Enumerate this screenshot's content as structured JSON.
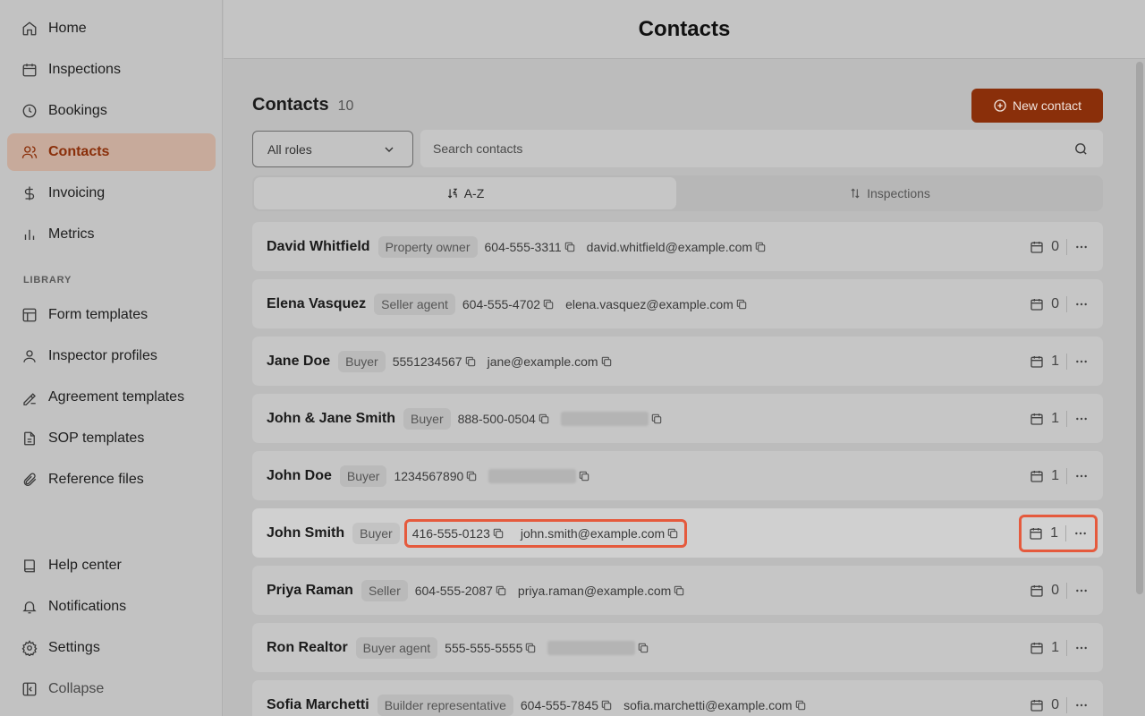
{
  "sidebar": {
    "items": [
      {
        "label": "Home",
        "icon": "home-icon"
      },
      {
        "label": "Inspections",
        "icon": "calendar-icon"
      },
      {
        "label": "Bookings",
        "icon": "clock-icon"
      },
      {
        "label": "Contacts",
        "icon": "users-icon",
        "active": true
      },
      {
        "label": "Invoicing",
        "icon": "dollar-icon"
      },
      {
        "label": "Metrics",
        "icon": "bar-chart-icon"
      }
    ],
    "library_label": "LIBRARY",
    "library_items": [
      {
        "label": "Form templates",
        "icon": "layout-icon"
      },
      {
        "label": "Inspector profiles",
        "icon": "user-icon"
      },
      {
        "label": "Agreement templates",
        "icon": "signature-icon"
      },
      {
        "label": "SOP templates",
        "icon": "file-icon"
      },
      {
        "label": "Reference files",
        "icon": "paperclip-icon"
      }
    ],
    "footer_items": [
      {
        "label": "Help center",
        "icon": "book-icon"
      },
      {
        "label": "Notifications",
        "icon": "bell-icon"
      },
      {
        "label": "Settings",
        "icon": "gear-icon"
      },
      {
        "label": "Collapse",
        "icon": "sidebar-collapse-icon"
      }
    ]
  },
  "header": {
    "title": "Contacts"
  },
  "main": {
    "section_title": "Contacts",
    "count": "10",
    "new_button": "New contact",
    "roles_select": "All roles",
    "search_placeholder": "Search contacts",
    "sort_tabs": [
      {
        "label": "A-Z",
        "active": true
      },
      {
        "label": "Inspections",
        "active": false
      }
    ]
  },
  "accent_color": "#8a2f0a",
  "highlight_color": "#e55a3d",
  "contacts": [
    {
      "name": "David Whitfield",
      "role": "Property owner",
      "phone": "604-555-3311",
      "email": "david.whitfield@example.com",
      "inspections": "0"
    },
    {
      "name": "Elena Vasquez",
      "role": "Seller agent",
      "phone": "604-555-4702",
      "email": "elena.vasquez@example.com",
      "inspections": "0"
    },
    {
      "name": "Jane Doe",
      "role": "Buyer",
      "phone": "5551234567",
      "email": "jane@example.com",
      "inspections": "1"
    },
    {
      "name": "John & Jane Smith",
      "role": "Buyer",
      "phone": "888-500-0504",
      "email": "",
      "inspections": "1"
    },
    {
      "name": "John Doe",
      "role": "Buyer",
      "phone": "1234567890",
      "email": "",
      "inspections": "1"
    },
    {
      "name": "John Smith",
      "role": "Buyer",
      "phone": "416-555-0123",
      "email": "john.smith@example.com",
      "inspections": "1",
      "highlighted": true
    },
    {
      "name": "Priya Raman",
      "role": "Seller",
      "phone": "604-555-2087",
      "email": "priya.raman@example.com",
      "inspections": "0"
    },
    {
      "name": "Ron Realtor",
      "role": "Buyer agent",
      "phone": "555-555-5555",
      "email": "",
      "inspections": "1"
    },
    {
      "name": "Sofia Marchetti",
      "role": "Builder representative",
      "phone": "604-555-7845",
      "email": "sofia.marchetti@example.com",
      "inspections": "0"
    }
  ]
}
